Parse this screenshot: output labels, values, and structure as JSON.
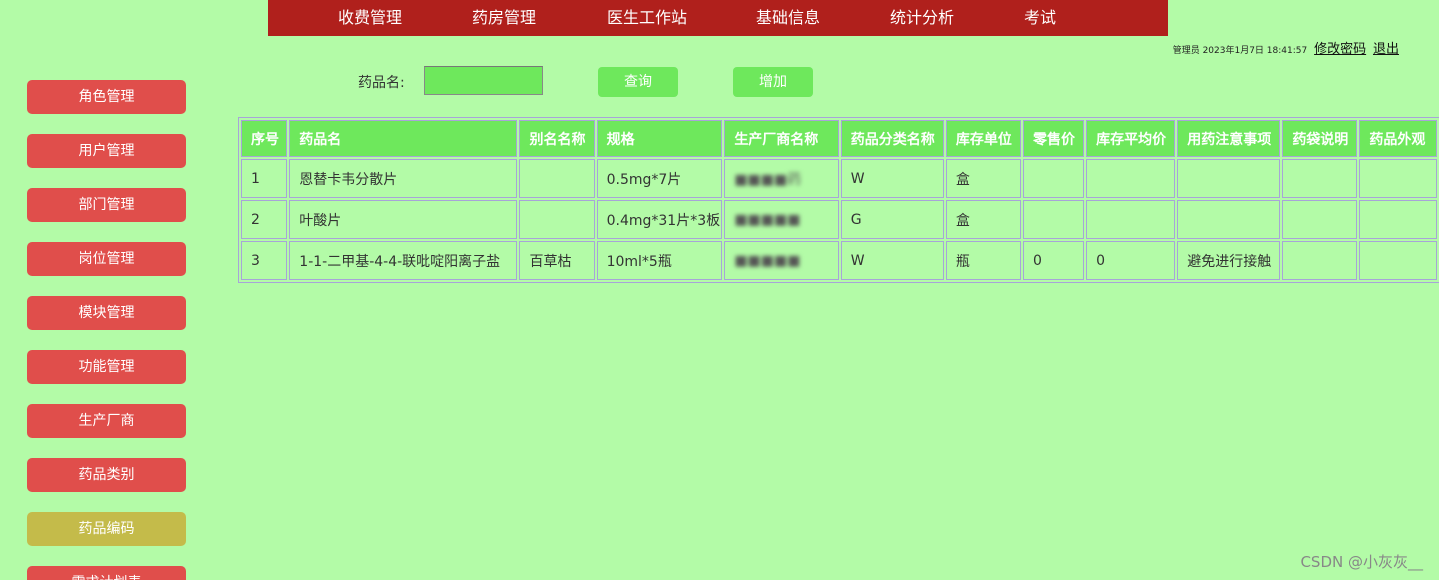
{
  "nav": {
    "items": [
      "收费管理",
      "药房管理",
      "医生工作站",
      "基础信息",
      "统计分析",
      "考试"
    ]
  },
  "userbar": {
    "role": "管理员",
    "datetime": "2023年1月7日 18:41:57",
    "change_password": "修改密码",
    "logout": "退出"
  },
  "sidebar": {
    "items": [
      "角色管理",
      "用户管理",
      "部门管理",
      "岗位管理",
      "模块管理",
      "功能管理",
      "生产厂商",
      "药品类别",
      "药品编码",
      "需求计划表"
    ],
    "active_index": 8
  },
  "search": {
    "label": "药品名:",
    "value": "",
    "query_button": "查询",
    "add_button": "增加"
  },
  "table": {
    "columns": [
      "序号",
      "药品名",
      "别名名称",
      "规格",
      "生产厂商名称",
      "药品分类名称",
      "库存单位",
      "零售价",
      "库存平均价",
      "用药注意事项",
      "药袋说明",
      "药品外观"
    ],
    "rows": [
      [
        "1",
        "恩替卡韦分散片",
        "",
        "0.5mg*7片",
        "■■■■药",
        "W",
        "盒",
        "",
        "",
        "",
        "",
        ""
      ],
      [
        "2",
        "叶酸片",
        "",
        "0.4mg*31片*3板",
        "■■■■■",
        "G",
        "盒",
        "",
        "",
        "",
        "",
        ""
      ],
      [
        "3",
        "1-1-二甲基-4-4-联吡啶阳离子盐",
        "百草枯",
        "10ml*5瓶",
        "■■■■■",
        "W",
        "瓶",
        "0",
        "0",
        "避免进行接触",
        "",
        ""
      ]
    ]
  },
  "watermark": "CSDN @小灰灰__",
  "colors": {
    "background": "#b3fba7",
    "nav_bg": "#b0201c",
    "sidebar_btn": "#e04e4b",
    "sidebar_active": "#c4bb4a",
    "accent_green": "#6ee85c"
  }
}
